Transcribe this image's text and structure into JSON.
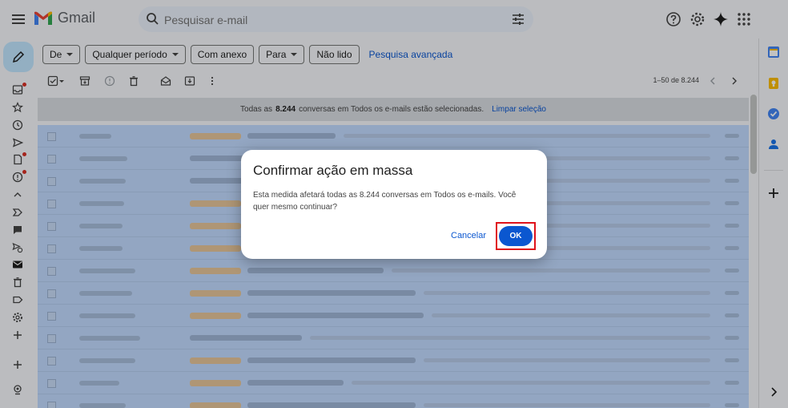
{
  "app": {
    "name": "Gmail"
  },
  "search": {
    "placeholder": "Pesquisar e-mail"
  },
  "filters": {
    "chips": [
      {
        "label": "De",
        "dropdown": true
      },
      {
        "label": "Qualquer período",
        "dropdown": true
      },
      {
        "label": "Com anexo",
        "dropdown": false
      },
      {
        "label": "Para",
        "dropdown": true
      },
      {
        "label": "Não lido",
        "dropdown": false
      }
    ],
    "advanced": "Pesquisa avançada"
  },
  "toolbar": {
    "pagination": "1–50 de 8.244"
  },
  "selection_banner": {
    "prefix": "Todas as",
    "count": "8.244",
    "suffix": "conversas em Todos os e-mails estão selecionadas.",
    "clear": "Limpar seleção"
  },
  "dialog": {
    "title": "Confirmar ação em massa",
    "message": "Esta medida afetará todas as 8.244 conversas em Todos os e-mails. Você quer mesmo continuar?",
    "cancel": "Cancelar",
    "ok": "OK"
  },
  "colors": {
    "accent": "#0b57d0",
    "selection": "#c2dbff",
    "highlight": "#e0121b",
    "compose": "#c2e7ff"
  },
  "icons": {
    "topbar": [
      "menu-icon",
      "gmail-logo",
      "search-icon",
      "search-options-icon",
      "help-icon",
      "settings-icon",
      "gemini-icon",
      "apps-icon"
    ],
    "leftnav": [
      "compose-icon",
      "inbox-icon",
      "starred-icon",
      "snoozed-icon",
      "sent-icon",
      "drafts-icon",
      "important-icon",
      "less-icon",
      "labels-icon",
      "chats-icon",
      "scheduled-icon",
      "all-mail-icon",
      "trash-icon",
      "label-icon",
      "manage-labels-icon",
      "create-label-icon",
      "add-icon",
      "upgrade-icon"
    ],
    "rightpanel": [
      "calendar-icon",
      "keep-icon",
      "tasks-icon",
      "contacts-icon",
      "add-addon-icon",
      "expand-panel-icon"
    ]
  }
}
